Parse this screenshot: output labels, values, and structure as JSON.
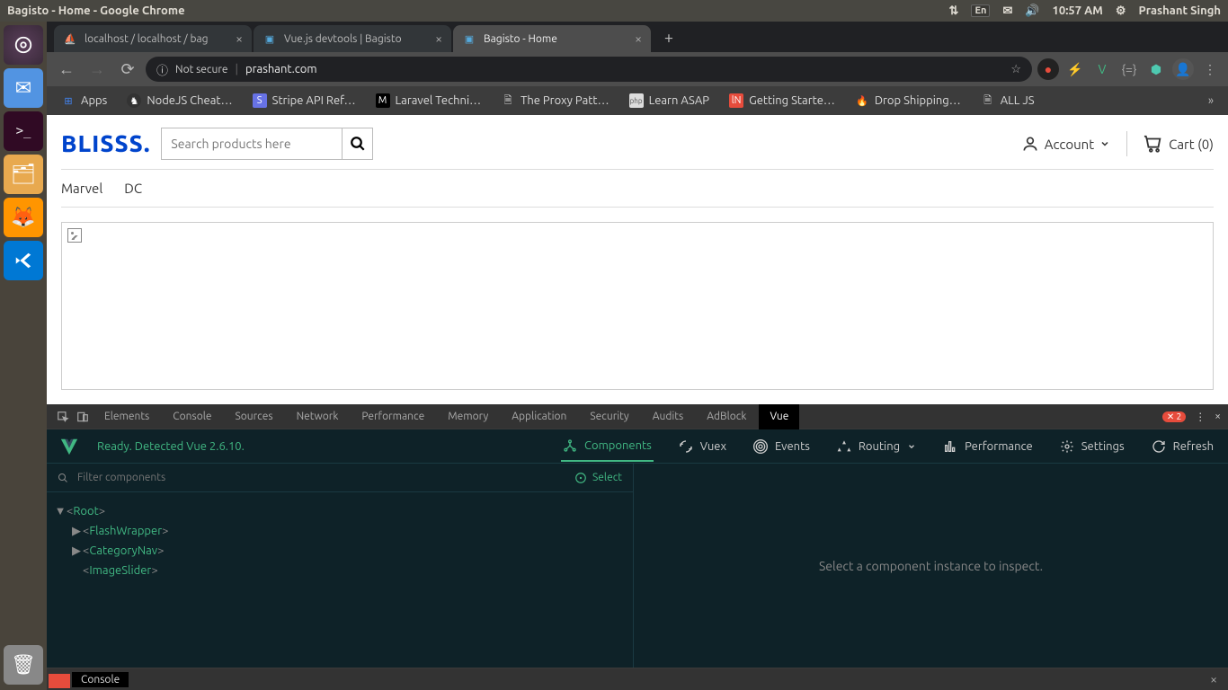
{
  "ubuntu": {
    "window_title": "Bagisto - Home - Google Chrome",
    "lang": "En",
    "time": "10:57 AM",
    "user": "Prashant Singh"
  },
  "chrome": {
    "tabs": [
      {
        "label": "localhost / localhost / bag",
        "active": false
      },
      {
        "label": "Vue.js devtools | Bagisto ",
        "active": false
      },
      {
        "label": "Bagisto - Home",
        "active": true
      }
    ],
    "omnibox": {
      "security": "Not secure",
      "url": "prashant.com"
    },
    "bookmarks": [
      {
        "label": "Apps",
        "icon": "grid"
      },
      {
        "label": "NodeJS Cheat…",
        "icon": "gh"
      },
      {
        "label": "Stripe API Ref…",
        "icon": "s"
      },
      {
        "label": "Laravel Techni…",
        "icon": "m"
      },
      {
        "label": "The Proxy Patt…",
        "icon": "doc"
      },
      {
        "label": "Learn ASAP",
        "icon": "php"
      },
      {
        "label": "Getting Starte…",
        "icon": "ln"
      },
      {
        "label": "Drop Shipping…",
        "icon": "ds"
      },
      {
        "label": "ALL JS",
        "icon": "doc"
      }
    ]
  },
  "store": {
    "logo": "BLISSS",
    "search_placeholder": "Search products here",
    "account_label": "Account",
    "cart_label": "Cart (0)",
    "categories": [
      "Marvel",
      "DC"
    ]
  },
  "devtools": {
    "tabs": [
      "Elements",
      "Console",
      "Sources",
      "Network",
      "Performance",
      "Memory",
      "Application",
      "Security",
      "Audits",
      "AdBlock",
      "Vue"
    ],
    "active_tab": "Vue",
    "error_count": "2",
    "vue": {
      "status": "Ready. Detected Vue 2.6.10.",
      "tabs": [
        "Components",
        "Vuex",
        "Events",
        "Routing",
        "Performance",
        "Settings",
        "Refresh"
      ],
      "active_tab": "Components",
      "filter_placeholder": "Filter components",
      "select_label": "Select",
      "tree": [
        {
          "indent": 0,
          "name": "Root",
          "arrow": "down"
        },
        {
          "indent": 1,
          "name": "FlashWrapper",
          "arrow": "right"
        },
        {
          "indent": 1,
          "name": "CategoryNav",
          "arrow": "right"
        },
        {
          "indent": 1,
          "name": "ImageSlider",
          "arrow": "none"
        }
      ],
      "inspect_msg": "Select a component instance to inspect."
    },
    "drawer_tab": "Console"
  }
}
